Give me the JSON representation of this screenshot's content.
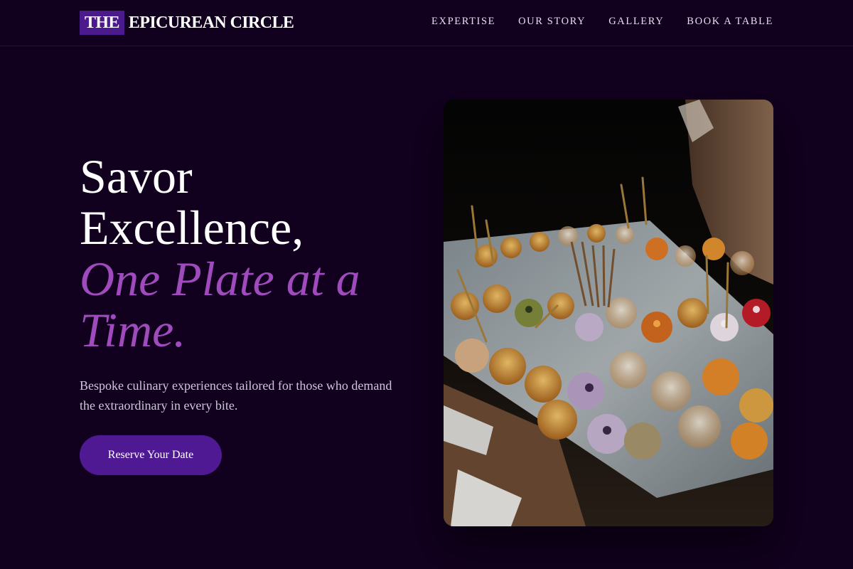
{
  "nav": {
    "logo_mark": "THE",
    "logo_text": "EPICUREAN CIRCLE",
    "links": [
      "EXPERTISE",
      "OUR STORY",
      "GALLERY",
      "BOOK A TABLE"
    ]
  },
  "hero": {
    "headline_line1": "Savor",
    "headline_line2": "Excellence,",
    "headline_accent": "One Plate at a Time.",
    "subtitle": "Bespoke culinary experiences tailored for those who demand the extraordinary in every bite.",
    "cta_label": "Reserve Your Date"
  },
  "colors": {
    "background": "#12001f",
    "accent": "#a04bbd",
    "button": "#4f1994",
    "logo_mark": "#4b1a8c"
  }
}
